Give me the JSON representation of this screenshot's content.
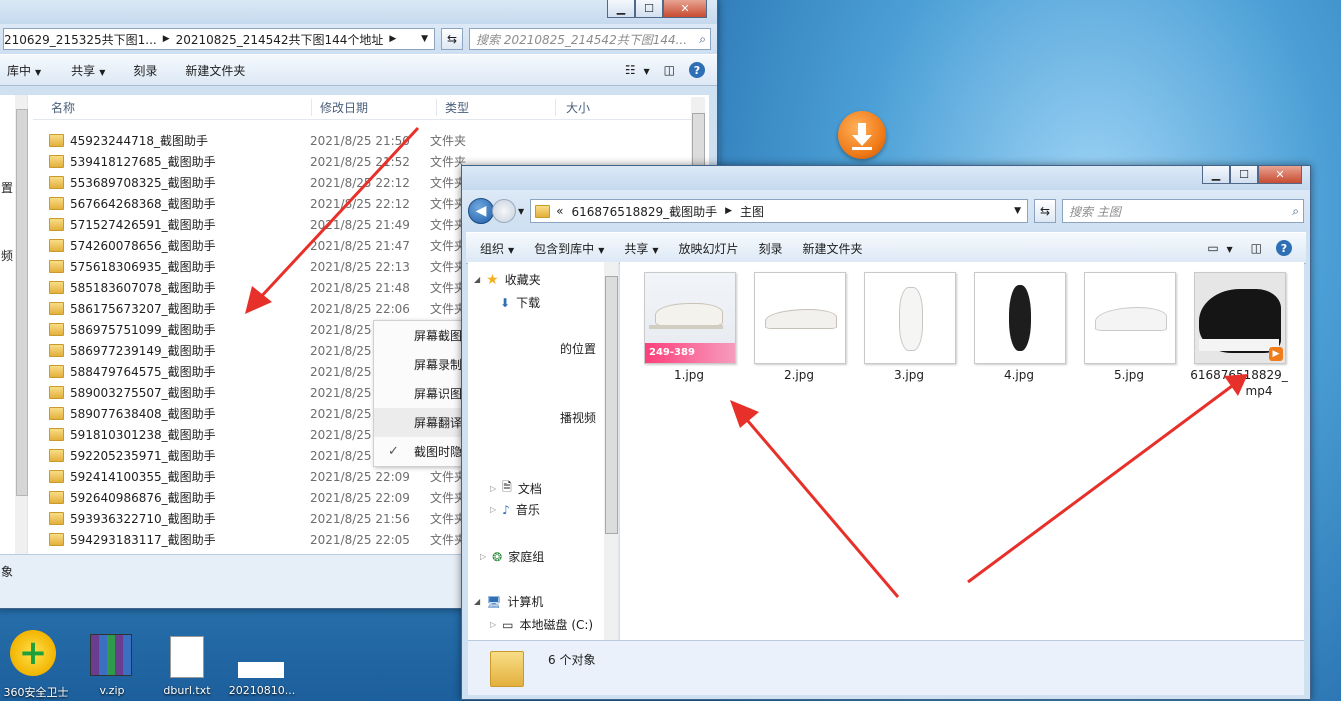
{
  "left_window": {
    "address_crumbs": [
      "210629_215325共下图1...",
      "20210825_214542共下图144个地址"
    ],
    "search_placeholder": "搜索 20210825_214542共下图144...",
    "toolbar": [
      "库中",
      "共享",
      "刻录",
      "新建文件夹"
    ],
    "columns": [
      "名称",
      "修改日期",
      "类型",
      "大小"
    ],
    "side_fragments": [
      "置",
      "频"
    ],
    "rows": [
      {
        "name": "45923244718_截图助手",
        "date": "2021/8/25 21:50",
        "type": "文件夹"
      },
      {
        "name": "539418127685_截图助手",
        "date": "2021/8/25 21:52",
        "type": "文件夹"
      },
      {
        "name": "553689708325_截图助手",
        "date": "2021/8/25 22:12",
        "type": "文件夹"
      },
      {
        "name": "567664268368_截图助手",
        "date": "2021/8/25 22:12",
        "type": "文件夹"
      },
      {
        "name": "571527426591_截图助手",
        "date": "2021/8/25 21:49",
        "type": "文件夹"
      },
      {
        "name": "574260078656_截图助手",
        "date": "2021/8/25 21:47",
        "type": "文件夹"
      },
      {
        "name": "575618306935_截图助手",
        "date": "2021/8/25 22:13",
        "type": "文件夹"
      },
      {
        "name": "585183607078_截图助手",
        "date": "2021/8/25 21:48",
        "type": "文件夹"
      },
      {
        "name": "586175673207_截图助手",
        "date": "2021/8/25 22:06",
        "type": "文件夹"
      },
      {
        "name": "586975751099_截图助手",
        "date": "2021/8/25",
        "type": ""
      },
      {
        "name": "586977239149_截图助手",
        "date": "2021/8/25",
        "type": ""
      },
      {
        "name": "588479764575_截图助手",
        "date": "2021/8/25",
        "type": ""
      },
      {
        "name": "589003275507_截图助手",
        "date": "2021/8/25",
        "type": ""
      },
      {
        "name": "589077638408_截图助手",
        "date": "2021/8/25",
        "type": ""
      },
      {
        "name": "591810301238_截图助手",
        "date": "2021/8/25",
        "type": ""
      },
      {
        "name": "592205235971_截图助手",
        "date": "2021/8/25",
        "type": ""
      },
      {
        "name": "592414100355_截图助手",
        "date": "2021/8/25 22:09",
        "type": "文件夹"
      },
      {
        "name": "592640986876_截图助手",
        "date": "2021/8/25 22:09",
        "type": "文件夹"
      },
      {
        "name": "593936322710_截图助手",
        "date": "2021/8/25 21:56",
        "type": "文件夹"
      },
      {
        "name": "594293183117_截图助手",
        "date": "2021/8/25 22:05",
        "type": "文件夹"
      }
    ],
    "status": "象"
  },
  "context_menu": {
    "items": [
      "屏幕截图 Ctrl + Alt + A",
      "屏幕录制 Ctrl + Alt + S",
      "屏幕识图 Ctrl + Alt + O",
      "屏幕翻译 Ctrl + Alt + F",
      "截图时隐藏当前窗口"
    ],
    "highlighted_index": 3,
    "checked_index": 4
  },
  "right_window": {
    "address_crumbs": [
      "«",
      "616876518829_截图助手",
      "主图"
    ],
    "search_placeholder": "搜索 主图",
    "toolbar": [
      "组织",
      "包含到库中",
      "共享",
      "放映幻灯片",
      "刻录",
      "新建文件夹"
    ],
    "nav": {
      "favorites": "收藏夹",
      "downloads": "下载",
      "fragment_location": "的位置",
      "fragment_video": "播视频",
      "documents": "文档",
      "music": "音乐",
      "homegroup": "家庭组",
      "computer": "计算机",
      "local_disk": "本地磁盘 (C:)"
    },
    "files": [
      {
        "label": "1.jpg",
        "price": "249-389"
      },
      {
        "label": "2.jpg"
      },
      {
        "label": "3.jpg"
      },
      {
        "label": "4.jpg"
      },
      {
        "label": "5.jpg"
      },
      {
        "label": "616876518829_"
      }
    ],
    "file6_ext": "mp4",
    "status": "6 个对象"
  },
  "desktop_icons": [
    "360安全卫士",
    "v.zip",
    "dburl.txt",
    "20210810..."
  ],
  "colors": {
    "arrow": "#e8302a",
    "accent": "#2f6fb5",
    "download": "#f07c1a"
  }
}
